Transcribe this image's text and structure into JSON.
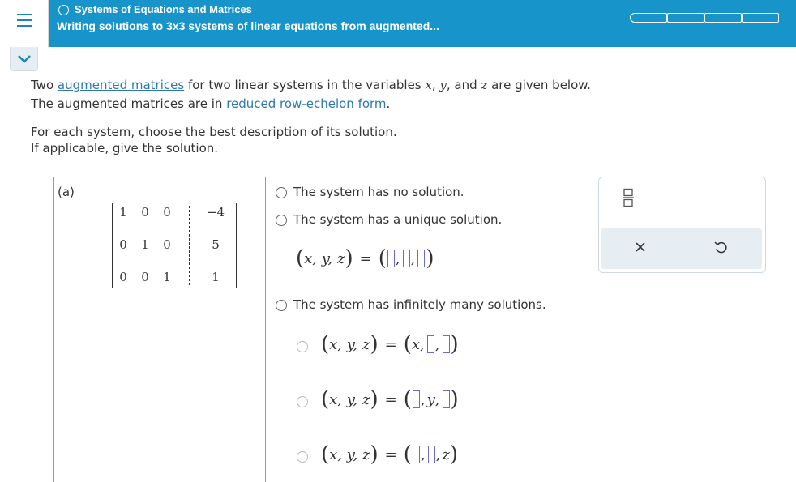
{
  "header": {
    "topic": "Systems of Equations and Matrices",
    "title": "Writing solutions to 3x3 systems of linear equations from augmented..."
  },
  "problem": {
    "line1_pre": "Two ",
    "line1_link": "augmented matrices",
    "line1_mid": " for two linear systems in the variables ",
    "var_x": "x",
    "sep1": ", ",
    "var_y": "y",
    "sep2": ", and ",
    "var_z": "z",
    "line1_post": " are given below.",
    "line2_pre": "The augmented matrices are in ",
    "line2_link": "reduced row-echelon form",
    "line2_post": ".",
    "line3": "For each system, choose the best description of its solution.",
    "line4": "If applicable, give the solution."
  },
  "part": {
    "label": "(a)",
    "matrix": [
      [
        "1",
        "0",
        "0",
        "−4"
      ],
      [
        "0",
        "1",
        "0",
        "5"
      ],
      [
        "0",
        "0",
        "1",
        "1"
      ]
    ]
  },
  "options": {
    "no_solution": "The system has no solution.",
    "unique_solution": "The system has a unique solution.",
    "infinite_solutions": "The system has infinitely many solutions."
  },
  "expr": {
    "lhs_open": "(",
    "lhs_vars": "x, y, z",
    "lhs_close": ")",
    "eq": "=",
    "open": "(",
    "close": ")",
    "comma": ",",
    "x": "x",
    "y": "y",
    "z": "z"
  },
  "tools": {
    "fraction_icon": "fraction-icon",
    "clear_icon": "x-icon",
    "undo_icon": "undo-icon"
  }
}
